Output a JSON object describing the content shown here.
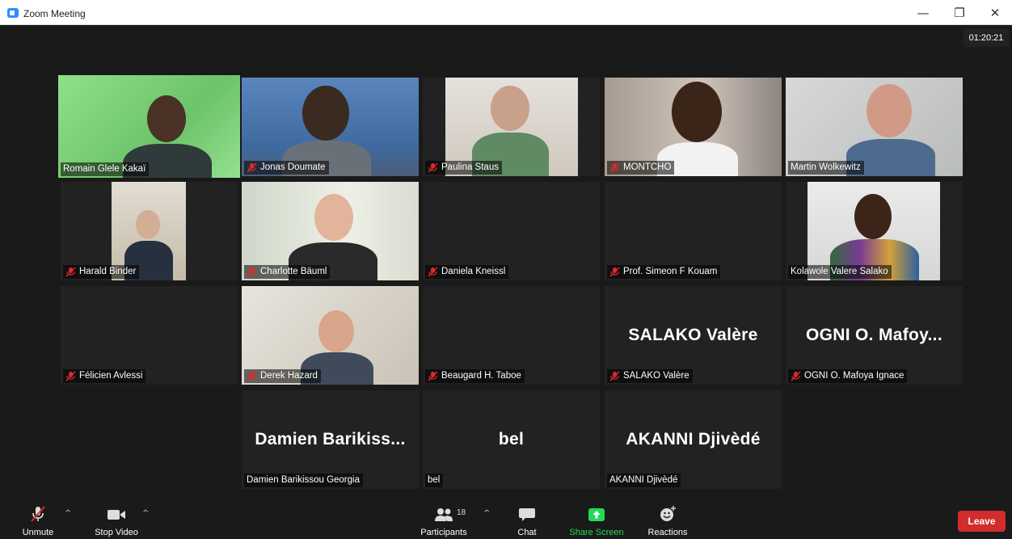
{
  "window": {
    "title": "Zoom Meeting",
    "minimize": "—",
    "restore": "❐",
    "close": "✕"
  },
  "timer": "01:20:21",
  "participants": [
    {
      "name": "Romain Glele Kakaï",
      "muted": false,
      "video": true,
      "active": true,
      "bg": "#7fd07a"
    },
    {
      "name": "Jonas Doumate",
      "muted": true,
      "video": true,
      "bg": "#4d6f9c"
    },
    {
      "name": "Paulina Staus",
      "muted": true,
      "video": true,
      "bg": "#d8d3cc"
    },
    {
      "name": "MONTCHO",
      "muted": true,
      "video": true,
      "bg": "#b8aca2"
    },
    {
      "name": "Martin Wolkewitz",
      "muted": false,
      "video": true,
      "bg": "#c6c8c7"
    },
    {
      "name": "Harald Binder",
      "muted": true,
      "video": true,
      "bg": "#cfcbc0"
    },
    {
      "name": "Charlotte Bäuml",
      "muted": true,
      "video": true,
      "bg": "#c9cfc3"
    },
    {
      "name": "Daniela Kneissl",
      "muted": true,
      "video": false
    },
    {
      "name": "Prof. Simeon F Kouam",
      "muted": true,
      "video": false
    },
    {
      "name": "Kolawole Valere Salako",
      "muted": false,
      "video": true,
      "bg": "#e4e5e3"
    },
    {
      "name": "Félicien Avlessi",
      "muted": true,
      "video": false
    },
    {
      "name": "Derek Hazard",
      "muted": true,
      "video": true,
      "bg": "#d9d6cf"
    },
    {
      "name": "Beaugard H. Taboe",
      "muted": true,
      "video": false
    },
    {
      "name": "SALAKO Valère",
      "muted": true,
      "video": false,
      "display": "SALAKO Valère"
    },
    {
      "name": "OGNI O. Mafoya Ignace",
      "muted": true,
      "video": false,
      "display": "OGNI O. Mafoy..."
    },
    {
      "name": "Damien Barikissou Georgia",
      "muted": false,
      "video": false,
      "display": "Damien Barikiss..."
    },
    {
      "name": "bel",
      "muted": false,
      "video": false,
      "display": "bel"
    },
    {
      "name": "AKANNI Djivèdé",
      "muted": false,
      "video": false,
      "display": "AKANNI Djivèdé"
    }
  ],
  "toolbar": {
    "unmute": "Unmute",
    "stop_video": "Stop Video",
    "participants": "Participants",
    "participants_count": "18",
    "chat": "Chat",
    "share_screen": "Share Screen",
    "reactions": "Reactions",
    "leave": "Leave",
    "caret": "^"
  },
  "colors": {
    "active_speaker": "#c1ef4f",
    "muted_red": "#e02828",
    "share_green": "#23d959",
    "leave_red": "#d32c2c"
  }
}
